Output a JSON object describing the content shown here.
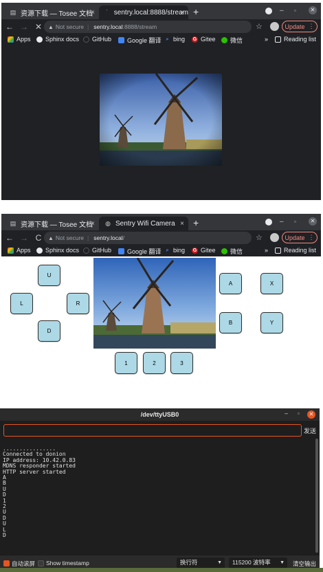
{
  "window1": {
    "tabs": [
      {
        "label": "资源下载 — Tosee 文档",
        "icon": "document-icon",
        "close": "×"
      },
      {
        "label": "sentry.local:8888/stream",
        "icon": "loading-icon",
        "close": "×"
      }
    ],
    "new_tab": "+",
    "security": "Not secure",
    "url_host": "sentry.local",
    "url_path": ":8888/stream",
    "update_label": "Update"
  },
  "window2": {
    "tabs": [
      {
        "label": "资源下载 — Tosee 文档",
        "icon": "document-icon",
        "close": "×"
      },
      {
        "label": "Sentry Wifi Camera",
        "icon": "globe-icon",
        "close": "×"
      }
    ],
    "new_tab": "+",
    "security": "Not secure",
    "url_host": "sentry.local",
    "url_path": "/",
    "update_label": "Update",
    "buttons": {
      "up": "U",
      "left": "L",
      "right": "R",
      "down": "D",
      "a": "A",
      "x": "X",
      "b": "B",
      "y": "Y",
      "one": "1",
      "two": "2",
      "three": "3"
    }
  },
  "bookmarks": {
    "apps": "Apps",
    "sphinx": "Sphinx docs",
    "github": "GitHub",
    "google": "Google 翻译",
    "bing": "bing",
    "gitee": "Gitee",
    "wechat": "微信",
    "more": "»",
    "reading_list": "Reading list"
  },
  "serial": {
    "title": "/dev/ttyUSB0",
    "send_label": "发送",
    "output": "................\nConnected to donion\nIP address: 10.42.0.83\nMDNS responder started\nHTTP server started\nA\nB\nU\nD\n1\n2\nU\nD\nU\nL\nD",
    "autoscroll_label": "自动滚屏",
    "timestamp_label": "Show timestamp",
    "line_ending": "换行符",
    "baud_rate": "115200 波特率",
    "clear_label": "清空输出"
  },
  "colors": {
    "chrome_dark": "#202124",
    "button_fill": "#add8e6",
    "serial_accent": "#e95420"
  }
}
